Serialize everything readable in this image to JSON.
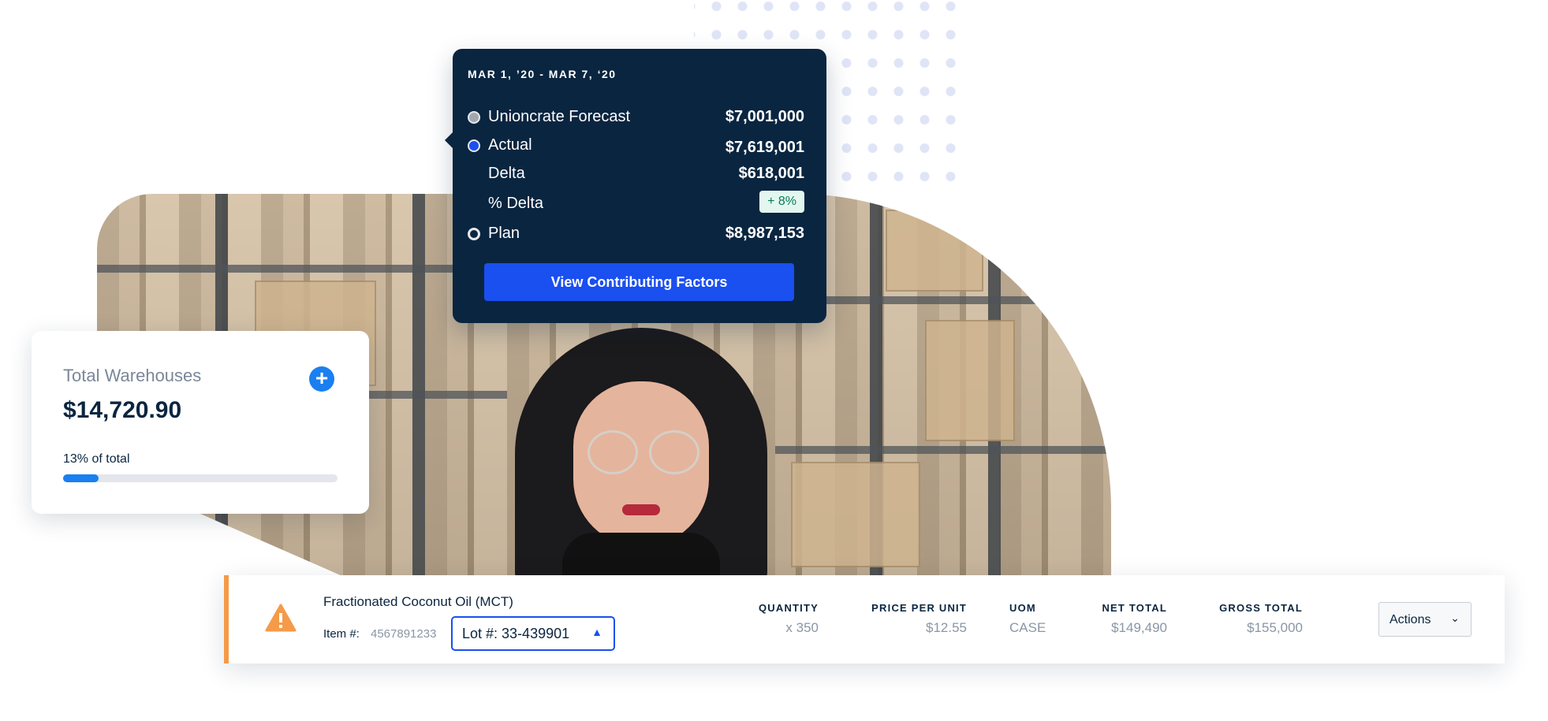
{
  "tooltip": {
    "date_range": "MAR 1, ’20 - MAR 7, ‘20",
    "rows": [
      {
        "label": "Unioncrate Forecast",
        "value": "$7,001,000"
      },
      {
        "label": "Actual",
        "value": "$7,619,001"
      },
      {
        "label": "Delta",
        "value": "$618,001"
      },
      {
        "label": "% Delta",
        "value": "+ 8%"
      },
      {
        "label": "Plan",
        "value": "$8,987,153"
      }
    ],
    "button_label": "View Contributing Factors",
    "colors": {
      "background": "#0a2540",
      "button": "#1a4ff0",
      "delta_pill_bg": "#e3f7f0",
      "delta_pill_text": "#0a7a55"
    }
  },
  "warehouse_card": {
    "title": "Total Warehouses",
    "amount": "$14,720.90",
    "percent_label": "13% of total",
    "progress_fraction": 0.13,
    "add_icon": "plus-circle-icon",
    "accent": "#1a7ff0"
  },
  "item_row": {
    "product_name": "Fractionated Coconut Oil (MCT)",
    "item_number_label": "Item #:",
    "item_number": "4567891233",
    "lot_select": "Lot #: 33-439901",
    "warning_icon": "warning-triangle-icon",
    "accent": "#f59a48",
    "columns": [
      {
        "header": "QUANTITY",
        "value": "x 350"
      },
      {
        "header": "PRICE PER UNIT",
        "value": "$12.55"
      },
      {
        "header": "UOM",
        "value": "CASE"
      },
      {
        "header": "NET TOTAL",
        "value": "$149,490"
      },
      {
        "header": "GROSS TOTAL",
        "value": "$155,000"
      }
    ],
    "actions_label": "Actions"
  }
}
